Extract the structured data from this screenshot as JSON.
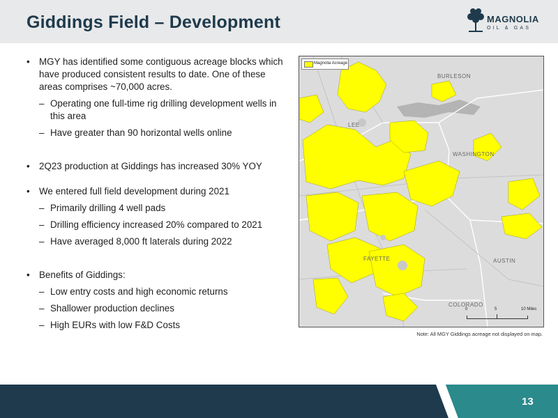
{
  "header": {
    "title": "Giddings Field – Development",
    "logo_line1": "MAGNOLIA",
    "logo_line2": "OIL & GAS"
  },
  "bullets": [
    {
      "level": 1,
      "text": "MGY has identified some contiguous acreage blocks which have produced consistent results to date. One of these areas comprises ~70,000 acres."
    },
    {
      "level": 2,
      "text": "Operating one full-time rig drilling development wells in this area"
    },
    {
      "level": 2,
      "text": "Have greater than 90 horizontal wells online"
    },
    {
      "level": 1,
      "text": "2Q23 production at Giddings has increased 30% YOY"
    },
    {
      "level": 1,
      "text": "We entered full field development during 2021"
    },
    {
      "level": 2,
      "text": "Primarily drilling 4 well pads"
    },
    {
      "level": 2,
      "text": "Drilling efficiency increased 20% compared to 2021"
    },
    {
      "level": 2,
      "text": "Have averaged 8,000 ft laterals during 2022"
    },
    {
      "level": 1,
      "text": "Benefits of Giddings:"
    },
    {
      "level": 2,
      "text": "Low entry costs and high economic returns"
    },
    {
      "level": 2,
      "text": "Shallower production declines"
    },
    {
      "level": 2,
      "text": "High EURs with low F&D Costs"
    }
  ],
  "map": {
    "legend_label": "Magnolia Acreage",
    "acreage_color": "#ffff00",
    "counties": {
      "burleson": "BURLESON",
      "lee": "LEE",
      "washington": "WASHINGTON",
      "fayette": "FAYETTE",
      "austin": "AUSTIN",
      "colorado": "COLORADO"
    },
    "scale": {
      "start": "0",
      "mid": "5",
      "end": "10 Miles"
    },
    "note": "Note: All MGY Giddings acreage not displayed on map."
  },
  "footer": {
    "page_number": "13",
    "bar_color": "#1e3a4c",
    "accent_color": "#2a8a8c"
  }
}
